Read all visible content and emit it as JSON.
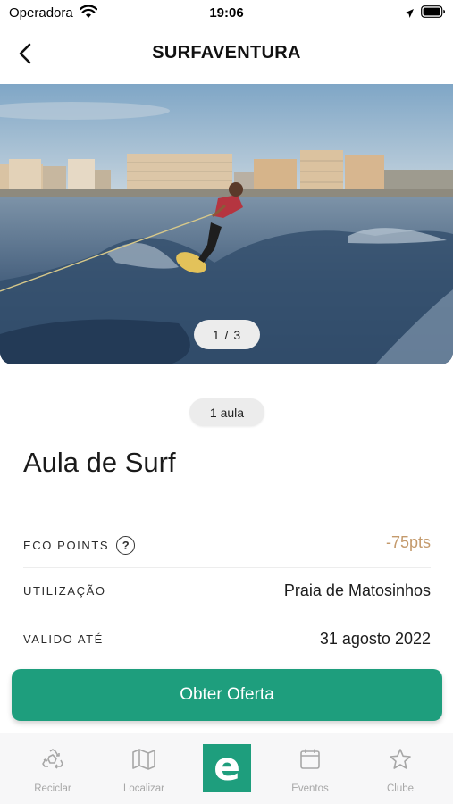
{
  "status_bar": {
    "carrier": "Operadora",
    "time": "19:06"
  },
  "nav": {
    "title": "SURFAVENTURA"
  },
  "gallery": {
    "pager": "1 / 3",
    "current_index": 1,
    "total": 3
  },
  "offer": {
    "quantity": "1 aula",
    "title": "Aula de Surf",
    "details": [
      {
        "label": "ECO POINTS",
        "value": "-75pts"
      },
      {
        "label": "UTILIZAÇÃO",
        "value": "Praia de Matosinhos"
      },
      {
        "label": "VALIDO ATÉ",
        "value": "31 agosto 2022"
      }
    ],
    "cta_label": "Obter Oferta"
  },
  "tab_bar": {
    "items": [
      {
        "label": "Reciclar",
        "icon": "recycle-icon"
      },
      {
        "label": "Localizar",
        "icon": "map-icon"
      },
      {
        "label": "e",
        "icon": "home-logo"
      },
      {
        "label": "Eventos",
        "icon": "calendar-icon"
      },
      {
        "label": "Clube",
        "icon": "star-icon"
      }
    ]
  },
  "colors": {
    "accent": "#1e9e7d",
    "points": "#c49a6c"
  }
}
